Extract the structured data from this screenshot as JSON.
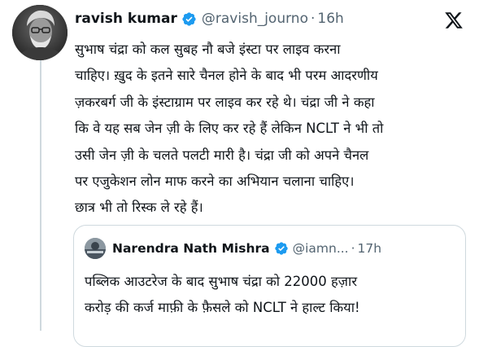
{
  "tweet": {
    "author": {
      "display_name": "ravish kumar",
      "handle": "@ravish_journo",
      "verified": true
    },
    "separator": "·",
    "timestamp": "16h",
    "text_lines": [
      "सुभाष चंद्रा को कल सुबह नौ बजे इंस्टा पर लाइव करना",
      "चाहिए। ख़ुद के इतने सारे चैनल होने के बाद भी परम आदरणीय",
      "ज़करबर्ग जी के इंस्टाग्राम पर लाइव कर रहे थे। चंद्रा जी ने कहा",
      "कि वे यह सब जेन ज़ी के लिए कर रहे हैं लेकिन NCLT ने भी तो",
      "उसी जेन ज़ी के चलते पलटी मारी है। चंद्रा जी को अपने चैनल",
      "पर एजुकेशन लोन माफ करने का अभियान चलाना चाहिए।",
      "छात्र भी तो रिस्क ले रहे हैं।"
    ]
  },
  "quoted_tweet": {
    "author": {
      "display_name": "Narendra Nath Mishra",
      "handle": "@iamn...",
      "verified": true
    },
    "separator": "·",
    "timestamp": "17h",
    "text_lines": [
      "पब्लिक आउटरेज के बाद सुभाष चंद्रा को 22000 हज़ार",
      "करोड़ की कर्ज माफ़ी के फ़ैसले को NCLT ने हाल्ट किया!"
    ]
  },
  "icons": {
    "verified": "verified-badge-icon",
    "brand": "x-logo-icon"
  },
  "colors": {
    "text_primary": "#0f1419",
    "text_secondary": "#536471",
    "verified_blue": "#1d9bf0",
    "border": "#cfd9de"
  }
}
